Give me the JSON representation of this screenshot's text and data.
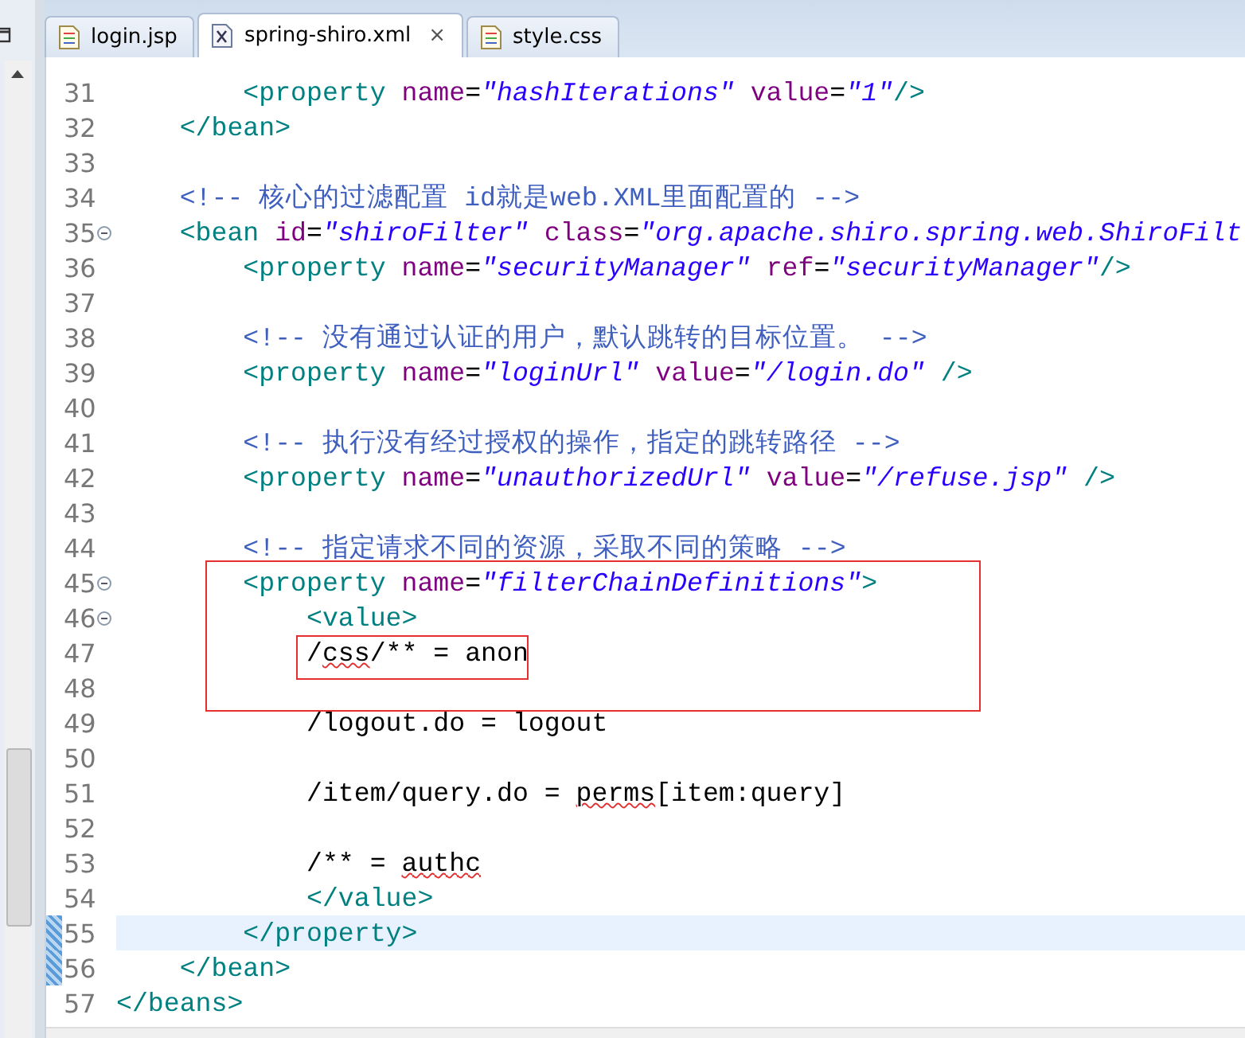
{
  "tabs": [
    {
      "label": "login.jsp",
      "kind": "page",
      "selected": false
    },
    {
      "label": "spring-shiro.xml",
      "kind": "xml",
      "selected": true,
      "closable": true
    },
    {
      "label": "style.css",
      "kind": "page",
      "selected": false
    }
  ],
  "close_glyph": "⨯",
  "lines": [
    {
      "number": "31",
      "segments": [
        {
          "kind": "tag",
          "text": "        <property "
        },
        {
          "kind": "attr",
          "text": "name"
        },
        {
          "kind": "punct",
          "text": "="
        },
        {
          "kind": "value",
          "text": "\"hashIterations\""
        },
        {
          "kind": "attr",
          "text": " value"
        },
        {
          "kind": "punct",
          "text": "="
        },
        {
          "kind": "value",
          "text": "\"1\""
        },
        {
          "kind": "tag",
          "text": "/>"
        }
      ]
    },
    {
      "number": "32",
      "segments": [
        {
          "kind": "tag",
          "text": "    </bean>"
        }
      ]
    },
    {
      "number": "33"
    },
    {
      "number": "34",
      "segments": [
        {
          "kind": "comment",
          "text": "    <!-- 核心的过滤配置 id就是web.XML里面配置的 -->"
        }
      ]
    },
    {
      "number": "35",
      "foldable": true,
      "segments": [
        {
          "kind": "tag",
          "text": "    <bean "
        },
        {
          "kind": "attr",
          "text": "id"
        },
        {
          "kind": "punct",
          "text": "="
        },
        {
          "kind": "value",
          "text": "\"shiroFilter\""
        },
        {
          "kind": "attr",
          "text": " class"
        },
        {
          "kind": "punct",
          "text": "="
        },
        {
          "kind": "value",
          "text": "\"org.apache.shiro.spring.web.ShiroFilt"
        }
      ]
    },
    {
      "number": "36",
      "segments": [
        {
          "kind": "tag",
          "text": "        <property "
        },
        {
          "kind": "attr",
          "text": "name"
        },
        {
          "kind": "punct",
          "text": "="
        },
        {
          "kind": "value",
          "text": "\"securityManager\""
        },
        {
          "kind": "attr",
          "text": " ref"
        },
        {
          "kind": "punct",
          "text": "="
        },
        {
          "kind": "value",
          "text": "\"securityManager\""
        },
        {
          "kind": "tag",
          "text": "/>"
        }
      ]
    },
    {
      "number": "37"
    },
    {
      "number": "38",
      "segments": [
        {
          "kind": "comment",
          "text": "        <!-- 没有通过认证的用户，默认跳转的目标位置。 -->"
        }
      ]
    },
    {
      "number": "39",
      "segments": [
        {
          "kind": "tag",
          "text": "        <property "
        },
        {
          "kind": "attr",
          "text": "name"
        },
        {
          "kind": "punct",
          "text": "="
        },
        {
          "kind": "value",
          "text": "\"loginUrl\""
        },
        {
          "kind": "attr",
          "text": " value"
        },
        {
          "kind": "punct",
          "text": "="
        },
        {
          "kind": "value",
          "text": "\"/login.do\""
        },
        {
          "kind": "tag",
          "text": " />"
        }
      ]
    },
    {
      "number": "40"
    },
    {
      "number": "41",
      "segments": [
        {
          "kind": "comment",
          "text": "        <!-- 执行没有经过授权的操作，指定的跳转路径 -->"
        }
      ]
    },
    {
      "number": "42",
      "segments": [
        {
          "kind": "tag",
          "text": "        <property "
        },
        {
          "kind": "attr",
          "text": "name"
        },
        {
          "kind": "punct",
          "text": "="
        },
        {
          "kind": "value",
          "text": "\"unauthorizedUrl\""
        },
        {
          "kind": "attr",
          "text": " value"
        },
        {
          "kind": "punct",
          "text": "="
        },
        {
          "kind": "value",
          "text": "\"/refuse.jsp\""
        },
        {
          "kind": "tag",
          "text": " />"
        }
      ]
    },
    {
      "number": "43"
    },
    {
      "number": "44",
      "segments": [
        {
          "kind": "comment",
          "text": "        <!-- 指定请求不同的资源，采取不同的策略 -->"
        }
      ]
    },
    {
      "number": "45",
      "foldable": true,
      "framed": true,
      "segments": [
        {
          "kind": "tag",
          "text": "        <property "
        },
        {
          "kind": "attr",
          "text": "name"
        },
        {
          "kind": "punct",
          "text": "="
        },
        {
          "kind": "value",
          "text": "\"filterChainDefinitions\""
        },
        {
          "kind": "tag",
          "text": ">"
        }
      ]
    },
    {
      "number": "46",
      "foldable": true,
      "framed": true,
      "segments": [
        {
          "kind": "tag",
          "text": "            <value>"
        }
      ]
    },
    {
      "number": "47",
      "framed": true,
      "boxed": true,
      "segments": [
        {
          "kind": "text",
          "text": "            /"
        },
        {
          "kind": "misspelled",
          "text": "css"
        },
        {
          "kind": "text",
          "text": "/** = anon"
        }
      ]
    },
    {
      "number": "48",
      "framed": true
    },
    {
      "number": "49",
      "segments": [
        {
          "kind": "text",
          "text": "            /logout.do = logout"
        }
      ]
    },
    {
      "number": "50"
    },
    {
      "number": "51",
      "segments": [
        {
          "kind": "text",
          "text": "            /item/query.do = "
        },
        {
          "kind": "misspelled",
          "text": "perms"
        },
        {
          "kind": "text",
          "text": "[item:query]"
        }
      ]
    },
    {
      "number": "52"
    },
    {
      "number": "53",
      "segments": [
        {
          "kind": "text",
          "text": "            /** = "
        },
        {
          "kind": "misspelled",
          "text": "authc"
        }
      ]
    },
    {
      "number": "54",
      "segments": [
        {
          "kind": "tag",
          "text": "            </value>"
        }
      ]
    },
    {
      "number": "55",
      "current": true,
      "marked": true,
      "segments": [
        {
          "kind": "tag",
          "text": "        </property>"
        }
      ]
    },
    {
      "number": "56",
      "marked": true,
      "segments": [
        {
          "kind": "tag",
          "text": "    </bean>"
        }
      ]
    },
    {
      "number": "57",
      "segments": [
        {
          "kind": "tag",
          "text": "</beans>"
        }
      ]
    }
  ]
}
